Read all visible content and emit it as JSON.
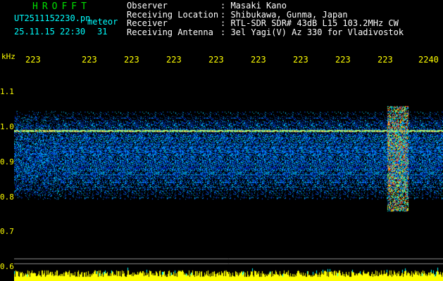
{
  "header": {
    "title": "HROFFT",
    "filename": "UT2511152230.pn",
    "meteor_label": "meteor",
    "date_time": "25.11.15 22:30",
    "meteor_count": "31"
  },
  "station": {
    "rows": [
      {
        "label": "Observer",
        "value": ": Masaki Kano"
      },
      {
        "label": "Receiving Location",
        "value": ": Shibukawa, Gunma, Japan"
      },
      {
        "label": "Receiver",
        "value": ": RTL-SDR SDR# 43dB L15 103.2MHz CW"
      },
      {
        "label": "Receiving Antenna",
        "value": ": 3el Yagi(V) Az 330 for Vladivostok"
      }
    ]
  },
  "axes": {
    "unit": "kHz",
    "time_ticks": [
      "223",
      "223",
      "223",
      "223",
      "223",
      "223",
      "223",
      "223",
      "223",
      "2240"
    ],
    "freq_ticks": [
      "1.1",
      "1.0",
      "0.9",
      "0.8",
      "0.7",
      "0.6"
    ]
  },
  "colors": {
    "title": "#00e000",
    "header_text": "#00ffff",
    "station_text": "#ffffff",
    "time_text": "#ffff00",
    "axis_text": "#ffff00",
    "carrier": "#f0d060",
    "noise_floor": "#ffff00",
    "noise_cyan": "#00ffff"
  }
}
